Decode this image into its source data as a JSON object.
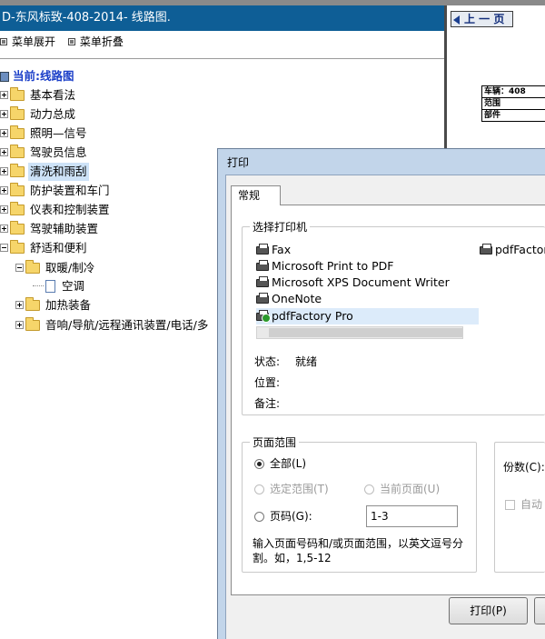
{
  "window": {
    "title": "D-东风标致-408-2014- 线路图."
  },
  "menu_controls": {
    "expand_label": "菜单展开",
    "collapse_label": "菜单折叠"
  },
  "tree": {
    "root_label": "当前:线路图",
    "items": [
      {
        "label": "基本看法"
      },
      {
        "label": "动力总成"
      },
      {
        "label": "照明—信号"
      },
      {
        "label": "驾驶员信息"
      },
      {
        "label": "清洗和雨刮"
      },
      {
        "label": "防护装置和车门"
      },
      {
        "label": "仪表和控制装置"
      },
      {
        "label": "驾驶辅助装置"
      },
      {
        "label": "舒适和便利"
      },
      {
        "label": "取暖/制冷"
      },
      {
        "label": "空调"
      },
      {
        "label": "加热装备"
      },
      {
        "label": "音响/导航/远程通讯装置/电话/多"
      }
    ]
  },
  "preview": {
    "prev_button_label": "上 一 页",
    "info_rows": [
      "车辆：408",
      "范围",
      "部件"
    ]
  },
  "print_dialog": {
    "title": "打印",
    "tab_label": "常规",
    "select_printer_title": "选择打印机",
    "printers": [
      {
        "name": "Fax"
      },
      {
        "name": "Microsoft Print to PDF"
      },
      {
        "name": "Microsoft XPS Document Writer"
      },
      {
        "name": "OneNote"
      },
      {
        "name": "pdfFactory Pro"
      },
      {
        "name": "pdfFactor"
      }
    ],
    "status_label": "状态:",
    "status_value": "就绪",
    "location_label": "位置:",
    "comment_label": "备注:",
    "page_range_title": "页面范围",
    "opt_all": "全部(L)",
    "opt_selection": "选定范围(T)",
    "opt_current": "当前页面(U)",
    "opt_pages": "页码(G):",
    "pages_value": "1-3",
    "hint_line1": "输入页面号码和/或页面范围，以英文逗号分",
    "hint_line2": "割。如，1,5-12",
    "copies_label": "份数(C):",
    "collate_label": "自动",
    "print_button": "打印(P)"
  }
}
